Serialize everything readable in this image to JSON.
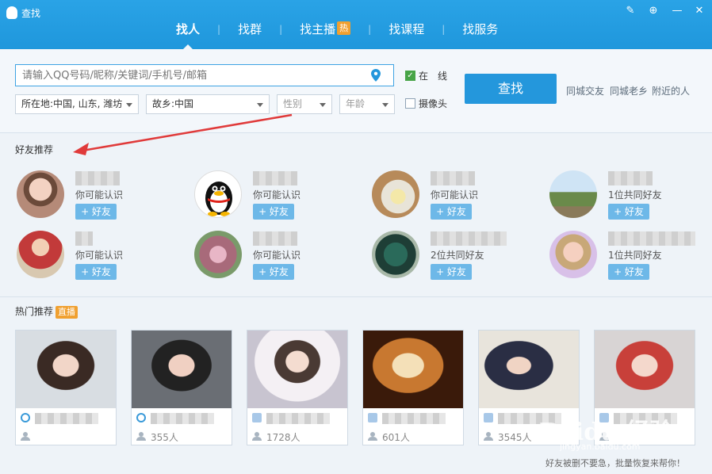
{
  "window": {
    "title": "查找",
    "btn_feedback": "✎",
    "btn_skin": "⊕",
    "btn_minimize": "—",
    "btn_close": "✕"
  },
  "tabs": [
    {
      "label": "找人",
      "active": true
    },
    {
      "label": "找群"
    },
    {
      "label": "找主播",
      "badge": "热"
    },
    {
      "label": "找课程"
    },
    {
      "label": "找服务"
    }
  ],
  "search": {
    "placeholder": "请输入QQ号码/昵称/关键词/手机号/邮箱",
    "location": "所在地:中国, 山东, 潍坊",
    "hometown": "故乡:中国",
    "gender": "性别",
    "age": "年龄",
    "online_label": "在　线",
    "online_checked": true,
    "camera_label": "摄像头",
    "camera_checked": false,
    "button": "查找",
    "quick_links": [
      "同城交友",
      "同城老乡",
      "附近的人"
    ]
  },
  "friend_rec": {
    "title": "好友推荐",
    "add_label": "+ 好友",
    "cards": [
      {
        "reason": "你可能认识",
        "avatar": "photo-girl"
      },
      {
        "reason": "你可能认识",
        "avatar": "qq-penguin"
      },
      {
        "reason": "你可能认识",
        "avatar": "photo-tea"
      },
      {
        "reason": "1位共同好友",
        "avatar": "photo-tower"
      },
      {
        "reason": "你可能认识",
        "avatar": "photo-child"
      },
      {
        "reason": "你可能认识",
        "avatar": "photo-flowers"
      },
      {
        "reason": "2位共同好友",
        "avatar": "photo-dragon"
      },
      {
        "reason": "1位共同好友",
        "avatar": "photo-girl2"
      }
    ]
  },
  "hot": {
    "title": "热门推荐",
    "badge": "直播",
    "cards": [
      {
        "count": ""
      },
      {
        "count": "355人"
      },
      {
        "count": "1728人"
      },
      {
        "count": "601人"
      },
      {
        "count": "3545人"
      },
      {
        "count": ""
      }
    ]
  },
  "watermark": {
    "text": "Baidu 经验",
    "sub": "jingyan.baidu.com"
  },
  "footer": "好友被删不要急，批量恢复来帮你！",
  "colors": {
    "titlebar": "#1f97dc",
    "accent": "#2497dc",
    "badge": "#f0a030",
    "add_button": "#6db8e8"
  }
}
